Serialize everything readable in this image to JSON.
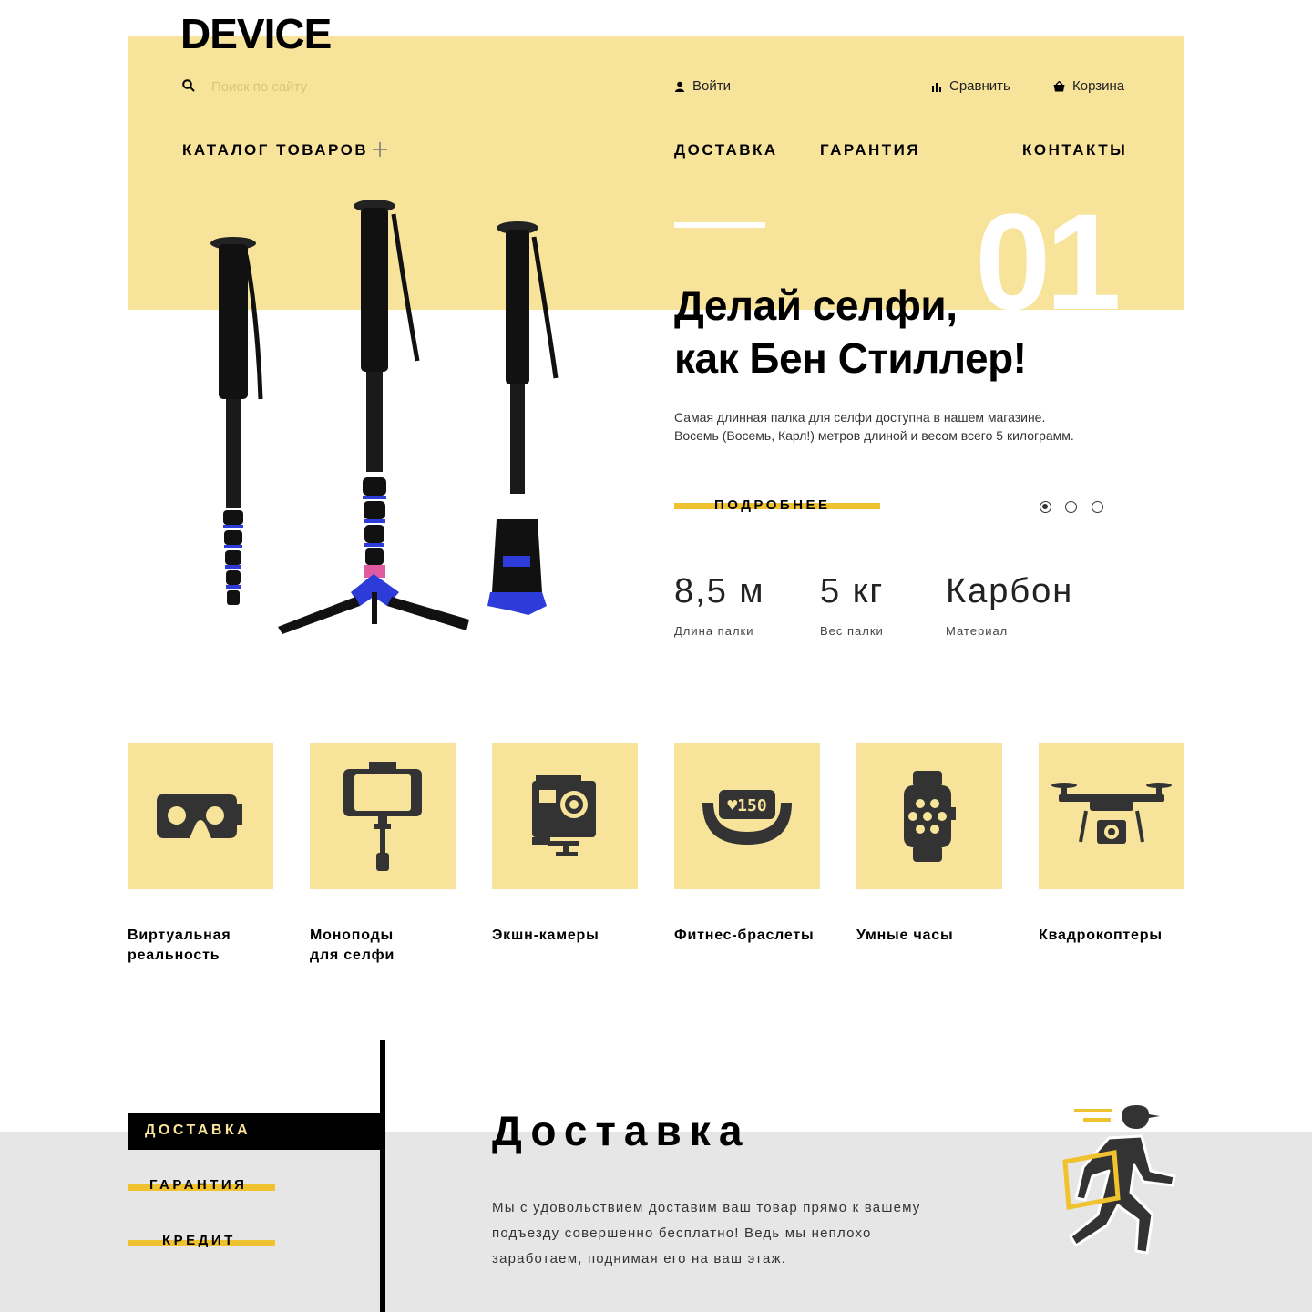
{
  "header": {
    "logo": "DEVICE",
    "search": {
      "placeholder": "Поиск по сайту",
      "value": ""
    },
    "login": "Войти",
    "compare": "Сравнить",
    "cart": "Корзина"
  },
  "nav": {
    "catalog": "КАТАЛОГ ТОВАРОВ",
    "delivery": "ДОСТАВКА",
    "warranty": "ГАРАНТИЯ",
    "contacts": "КОНТАКТЫ"
  },
  "hero": {
    "slide_number": "01",
    "title_line1": "Делай селфи,",
    "title_line2": "как Бен Стиллер!",
    "desc_line1": "Самая длинная палка для селфи доступна в нашем магазине.",
    "desc_line2": "Восемь (Восемь, Карл!) метров длиной и весом всего 5 килограмм.",
    "more_button": "ПОДРОБНЕЕ",
    "slider": {
      "count": 3,
      "active": 1
    },
    "stats": [
      {
        "value": "8,5 м",
        "label": "Длина палки"
      },
      {
        "value": "5 кг",
        "label": "Вес палки"
      },
      {
        "value": "Карбон",
        "label": "Материал"
      }
    ]
  },
  "categories": [
    {
      "icon": "vr-headset-icon",
      "line1": "Виртуальная",
      "line2": "реальность"
    },
    {
      "icon": "selfie-monopod-icon",
      "line1": "Моноподы",
      "line2": "для селфи"
    },
    {
      "icon": "action-camera-icon",
      "line1": "Экшн-камеры",
      "line2": ""
    },
    {
      "icon": "fitness-band-icon",
      "line1": "Фитнес-браслеты",
      "line2": "",
      "band_display": "♥150"
    },
    {
      "icon": "smartwatch-icon",
      "line1": "Умные часы",
      "line2": ""
    },
    {
      "icon": "quadcopter-icon",
      "line1": "Квадрокоптеры",
      "line2": ""
    }
  ],
  "services": {
    "tabs": [
      "ДОСТАВКА",
      "ГАРАНТИЯ",
      "КРЕДИТ"
    ],
    "active_tab": 0,
    "title": "Доставка",
    "text": "Мы с удовольствием доставим ваш товар прямо к вашему подъезду совершенно бесплатно! Ведь мы неплохо заработаем, поднимая его на ваш этаж."
  },
  "colors": {
    "accent_light": "#f7e39a",
    "accent": "#f0c22f",
    "gray": "#e6e6e6",
    "text": "#000000"
  }
}
